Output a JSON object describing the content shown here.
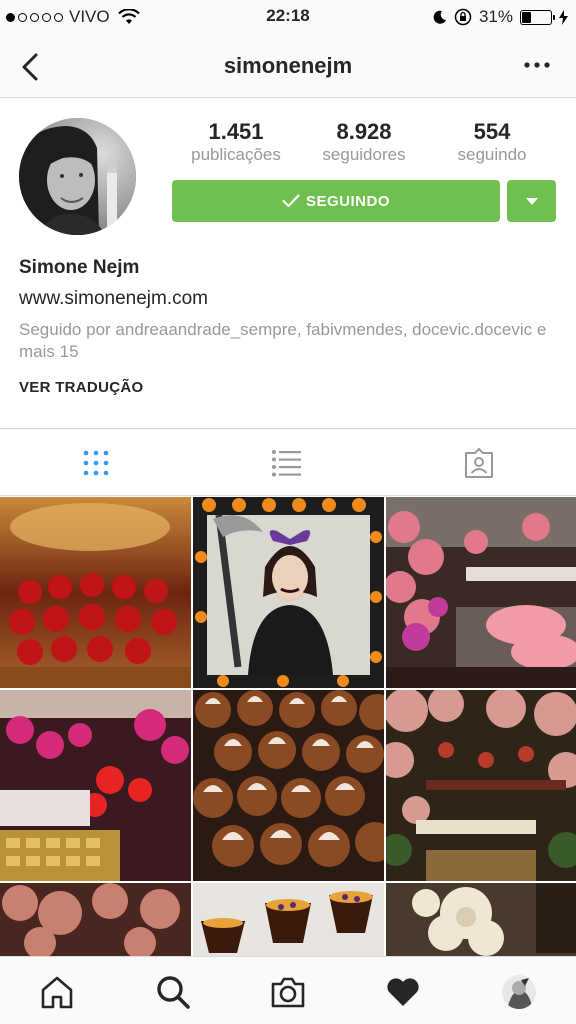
{
  "status_bar": {
    "carrier": "VIVO",
    "time": "22:18",
    "battery_percent": "31%",
    "battery_level": 0.31,
    "signal_bars_filled": 1,
    "signal_bars_total": 5
  },
  "nav": {
    "title": "simonenejm",
    "back_icon": "chevron-left-icon",
    "more_icon": "more-horizontal-icon"
  },
  "profile": {
    "stats": [
      {
        "value": "1.451",
        "label": "publicações"
      },
      {
        "value": "8.928",
        "label": "seguidores"
      },
      {
        "value": "554",
        "label": "seguindo"
      }
    ],
    "follow_button_label": "SEGUINDO",
    "full_name": "Simone Nejm",
    "website": "www.simonenejm.com",
    "followed_by": "Seguido por andreaandrade_sempre, fabivmendes, docevic.docevic e mais 15",
    "translate_label": "VER TRADUÇÃO"
  },
  "view_tabs": [
    {
      "icon": "grid-icon",
      "active": true
    },
    {
      "icon": "list-icon",
      "active": false
    },
    {
      "icon": "tagged-photos-icon",
      "active": false
    }
  ],
  "bottom_tabs": [
    {
      "icon": "home-icon"
    },
    {
      "icon": "search-icon"
    },
    {
      "icon": "camera-icon"
    },
    {
      "icon": "heart-icon"
    },
    {
      "icon": "profile-avatar-icon"
    }
  ],
  "colors": {
    "accent_green": "#70c050",
    "active_tab_blue": "#3897f0",
    "muted_text": "#999999"
  }
}
